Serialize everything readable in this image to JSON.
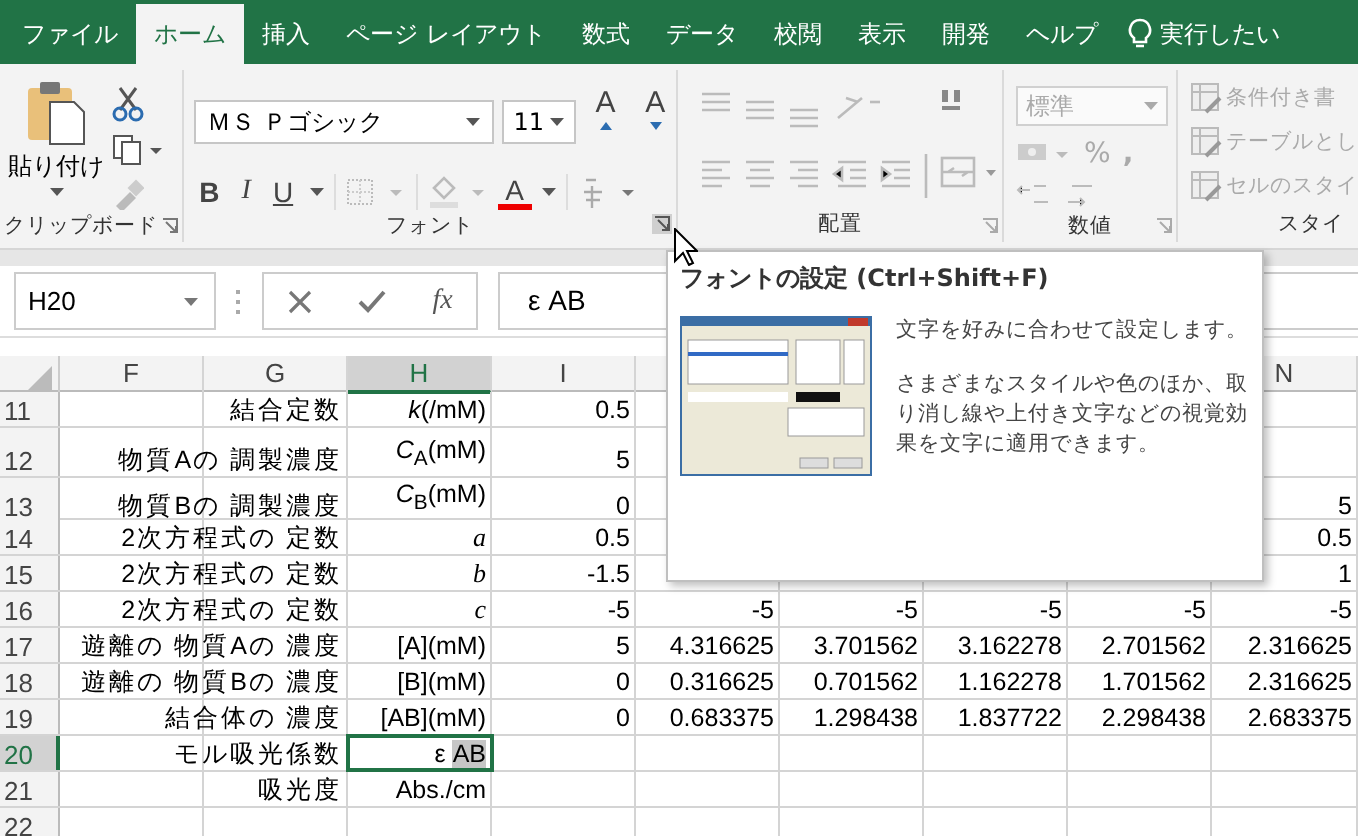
{
  "tabs": [
    {
      "label": "ファイル",
      "selected": false
    },
    {
      "label": "ホーム",
      "selected": true
    },
    {
      "label": "挿入",
      "selected": false
    },
    {
      "label": "ページ レイアウト",
      "selected": false
    },
    {
      "label": "数式",
      "selected": false
    },
    {
      "label": "データ",
      "selected": false
    },
    {
      "label": "校閲",
      "selected": false
    },
    {
      "label": "表示",
      "selected": false
    },
    {
      "label": "開発",
      "selected": false
    },
    {
      "label": "ヘルプ",
      "selected": false
    }
  ],
  "tell_me": "実行したい",
  "ribbon": {
    "clipboard": {
      "paste": "貼り付け",
      "label": "クリップボード"
    },
    "font": {
      "name": "ＭＳ Ｐゴシック",
      "size": "11",
      "grow": "A",
      "shrink": "A",
      "bold": "B",
      "italic": "I",
      "underline": "U",
      "color_letter": "A",
      "label": "フォント"
    },
    "alignment": {
      "label": "配置"
    },
    "number": {
      "format": "標準",
      "percent": "%",
      "comma": ",",
      "label": "数値"
    },
    "styles": {
      "disabled": true,
      "items": [
        "条件付き書",
        "テーブルとし",
        "セルのスタイ"
      ],
      "label": "スタイ"
    }
  },
  "formula_bar": {
    "name_box": "H20",
    "fx": "fx",
    "content": "ε AB"
  },
  "sheet": {
    "columns": [
      {
        "label": "F",
        "selected": false
      },
      {
        "label": "G",
        "selected": false
      },
      {
        "label": "H",
        "selected": true
      },
      {
        "label": "I",
        "selected": false
      },
      null,
      null,
      null,
      null,
      {
        "label": "N",
        "selected": false
      }
    ],
    "rows": [
      {
        "number": "11",
        "selected": false,
        "cells": [
          null,
          "結合定数",
          "*k*(/mM)",
          "0.5",
          null,
          null,
          null,
          null,
          null
        ]
      },
      {
        "number": "12",
        "selected": false,
        "cells": [
          null,
          "物質Aの 調製濃度",
          "*C*$_{A}$(mM)",
          "5",
          null,
          null,
          null,
          null,
          null
        ]
      },
      {
        "number": "13",
        "selected": false,
        "cells": [
          null,
          "物質Bの 調製濃度",
          "*C*$_{B}$(mM)",
          "0",
          null,
          null,
          null,
          null,
          "5"
        ]
      },
      {
        "number": "14",
        "selected": false,
        "cells": [
          null,
          "2次方程式の 定数",
          {
            "text": "a",
            "italic": true
          },
          "0.5",
          null,
          null,
          null,
          null,
          "0.5"
        ]
      },
      {
        "number": "15",
        "selected": false,
        "cells": [
          null,
          "2次方程式の 定数",
          {
            "text": "b",
            "italic": true
          },
          "-1.5",
          null,
          null,
          null,
          null,
          "1"
        ]
      },
      {
        "number": "16",
        "selected": false,
        "cells": [
          null,
          "2次方程式の 定数",
          {
            "text": "c",
            "italic": true
          },
          "-5",
          "-5",
          "-5",
          "-5",
          "-5",
          "-5"
        ]
      },
      {
        "number": "17",
        "selected": false,
        "cells": [
          null,
          "遊離の 物質Aの 濃度",
          "[A](mM)",
          "5",
          "4.316625",
          "3.701562",
          "3.162278",
          "2.701562",
          "2.316625"
        ]
      },
      {
        "number": "18",
        "selected": false,
        "cells": [
          null,
          "遊離の 物質Bの 濃度",
          "[B](mM)",
          "0",
          "0.316625",
          "0.701562",
          "1.162278",
          "1.701562",
          "2.316625"
        ]
      },
      {
        "number": "19",
        "selected": false,
        "cells": [
          null,
          "結合体の 濃度",
          "[AB](mM)",
          "0",
          "0.683375",
          "1.298438",
          "1.837722",
          "2.298438",
          "2.683375"
        ]
      },
      {
        "number": "20",
        "selected": true,
        "cells": [
          null,
          "モル吸光係数",
          {
            "text": "ε",
            "selected_text": "AB",
            "active": true
          },
          null,
          null,
          null,
          null,
          null,
          null
        ]
      },
      {
        "number": "21",
        "selected": false,
        "cells": [
          null,
          "吸光度",
          "Abs./cm",
          null,
          null,
          null,
          null,
          null,
          null
        ]
      },
      {
        "number": "22",
        "selected": false,
        "cells": [
          null,
          null,
          null,
          null,
          null,
          null,
          null,
          null,
          null
        ]
      }
    ]
  },
  "tooltip": {
    "title": "フォントの設定 (Ctrl+Shift+F)",
    "paragraphs": [
      "文字を好みに合わせて設定します。",
      "さまざまなスタイルや色のほか、取り消し線や上付き文字などの視覚効果を文字に適用できます。"
    ],
    "thumbnail": {
      "kind": "picture"
    }
  }
}
